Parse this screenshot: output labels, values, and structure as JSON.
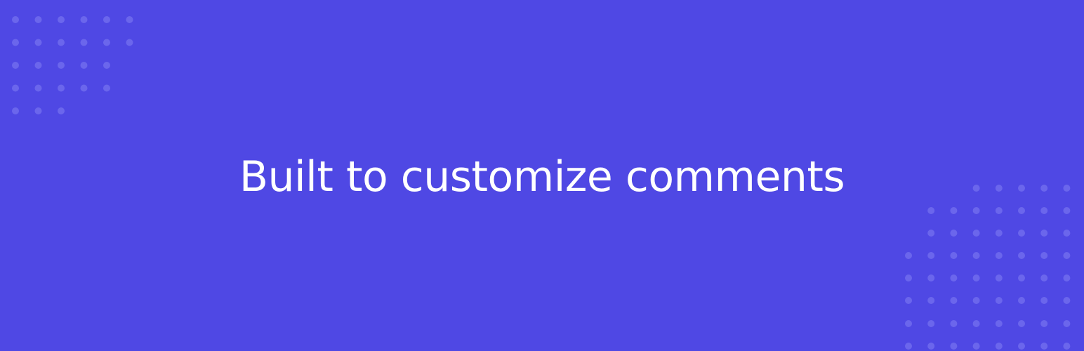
{
  "banner": {
    "headline": "Built to customize comments"
  },
  "colors": {
    "background": "#4f48e4",
    "text": "#ffffff",
    "dots": "#6b66ec"
  },
  "decorations": {
    "top_left_pattern": "dot-grid",
    "bottom_right_pattern": "dot-grid"
  }
}
